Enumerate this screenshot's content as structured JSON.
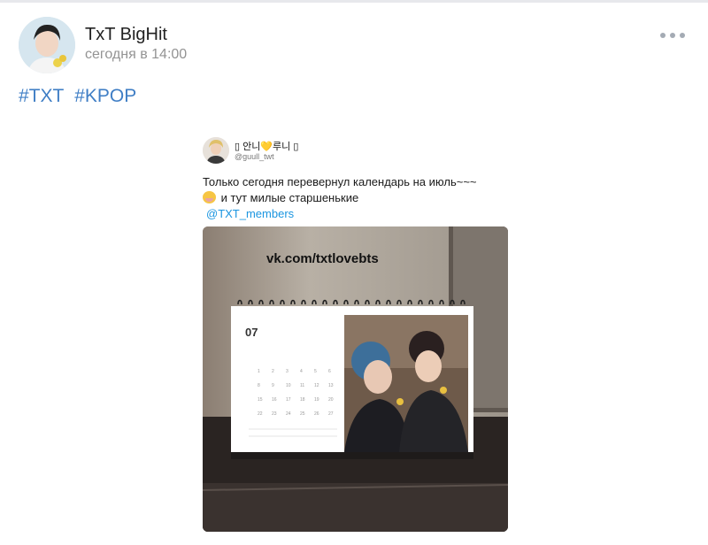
{
  "post": {
    "author": "TxT BigHit",
    "time": "сегодня в 14:00",
    "avatar_icon": "user-avatar-icon",
    "more_icon": "more-horizontal-icon"
  },
  "hashtags": [
    "#TXT",
    "#KPOP"
  ],
  "tweet": {
    "display_name": "▯ 안니💛루니 ▯",
    "handle": "@guull_twt",
    "text_line1": "Только сегодня перевернул календарь на июль~~~",
    "text_line2": "и тут милые старшенькие",
    "mention": "@TXT_members"
  },
  "photo": {
    "watermark": "vk.com/txtlovebts",
    "calendar_month": "07"
  },
  "colors": {
    "link": "#3f7ec5",
    "twitter_link": "#1b95e0",
    "muted": "#939393"
  }
}
